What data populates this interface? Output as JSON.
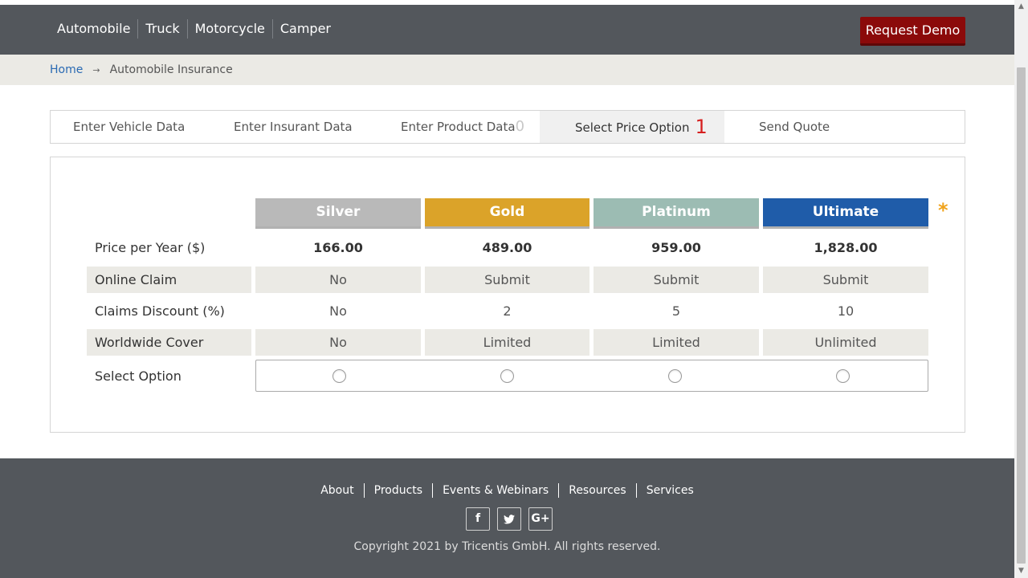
{
  "nav": {
    "items": [
      "Automobile",
      "Truck",
      "Motorcycle",
      "Camper"
    ],
    "demo_button": "Request Demo"
  },
  "breadcrumb": {
    "home": "Home",
    "separator": "→",
    "current": "Automobile Insurance"
  },
  "tabs": [
    {
      "label": "Enter Vehicle Data",
      "count": ""
    },
    {
      "label": "Enter Insurant Data",
      "count": ""
    },
    {
      "label": "Enter Product Data",
      "count": "0"
    },
    {
      "label": "Select Price Option",
      "count": "1"
    },
    {
      "label": "Send Quote",
      "count": ""
    }
  ],
  "plans": [
    "Silver",
    "Gold",
    "Platinum",
    "Ultimate"
  ],
  "required_marker": "*",
  "rows": [
    {
      "label": "Price per Year ($)",
      "values": [
        "166.00",
        "489.00",
        "959.00",
        "1,828.00"
      ]
    },
    {
      "label": "Online Claim",
      "values": [
        "No",
        "Submit",
        "Submit",
        "Submit"
      ]
    },
    {
      "label": "Claims Discount (%)",
      "values": [
        "No",
        "2",
        "5",
        "10"
      ]
    },
    {
      "label": "Worldwide Cover",
      "values": [
        "No",
        "Limited",
        "Limited",
        "Unlimited"
      ]
    }
  ],
  "select_option_label": "Select Option",
  "footer": {
    "links": [
      "About",
      "Products",
      "Events & Webinars",
      "Resources",
      "Services"
    ],
    "social": [
      "f",
      "t",
      "G+"
    ],
    "copyright": "Copyright 2021 by Tricentis GmbH. All rights reserved."
  },
  "colors": {
    "header_bg": "#53575c",
    "demo_button": "#8b0a0a",
    "silver": "#b9b9b9",
    "gold": "#dba329",
    "platinum": "#9cbcb3",
    "ultimate": "#1f5ca9",
    "active_count": "#d61f1f"
  }
}
